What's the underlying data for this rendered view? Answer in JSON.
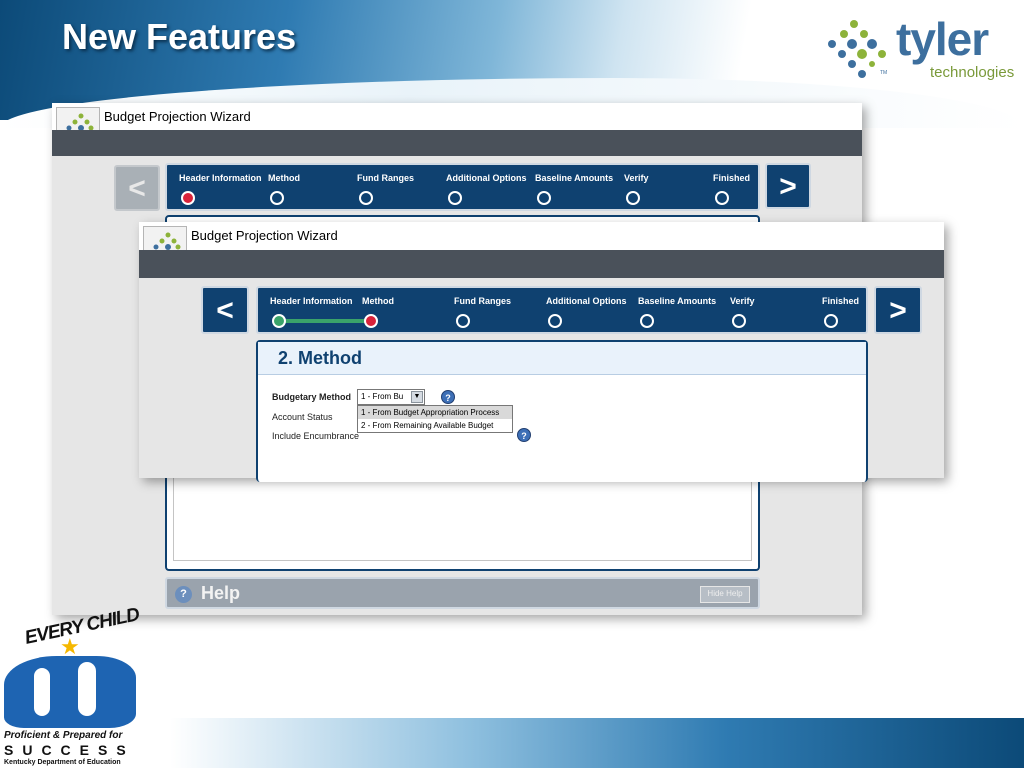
{
  "slide": {
    "title": "New Features"
  },
  "tyler_logo": {
    "word": "tyler",
    "sub": "technologies",
    "tm": "TM"
  },
  "back_window": {
    "title": "Budget Projection Wizard",
    "steps": [
      {
        "label": "Header Information",
        "state": "active"
      },
      {
        "label": "Method",
        "state": "pending"
      },
      {
        "label": "Fund Ranges",
        "state": "pending"
      },
      {
        "label": "Additional Options",
        "state": "pending"
      },
      {
        "label": "Baseline Amounts",
        "state": "pending"
      },
      {
        "label": "Verify",
        "state": "pending"
      },
      {
        "label": "Finished",
        "state": "pending"
      }
    ],
    "prev_label": "<",
    "next_label": ">",
    "help": {
      "icon_text": "?",
      "label": "Help",
      "hide_label": "Hide Help"
    }
  },
  "front_window": {
    "title": "Budget Projection Wizard",
    "steps": [
      {
        "label": "Header Information",
        "state": "done"
      },
      {
        "label": "Method",
        "state": "active"
      },
      {
        "label": "Fund Ranges",
        "state": "pending"
      },
      {
        "label": "Additional Options",
        "state": "pending"
      },
      {
        "label": "Baseline Amounts",
        "state": "pending"
      },
      {
        "label": "Verify",
        "state": "pending"
      },
      {
        "label": "Finished",
        "state": "pending"
      }
    ],
    "prev_label": "<",
    "next_label": ">",
    "panel_title": "2. Method",
    "form": {
      "budgetary_method_label": "Budgetary Method",
      "budgetary_method_value": "1 - From Bu",
      "account_status_label": "Account Status",
      "include_encumbrance_label": "Include Encumbrance",
      "help_icon_text": "?",
      "dropdown_arrow": "▼",
      "dropdown_options": [
        "1 - From Budget Appropriation Process",
        "2 - From Remaining Available Budget"
      ]
    }
  },
  "ky_logo": {
    "title": "EVERY CHILD",
    "line1": "Proficient & Prepared for",
    "line2": "SUCCESS",
    "line3": "Kentucky Department of Education"
  },
  "colors": {
    "navy": "#0f4170",
    "active_step": "#d9233a",
    "done_step": "#3aa36a"
  }
}
